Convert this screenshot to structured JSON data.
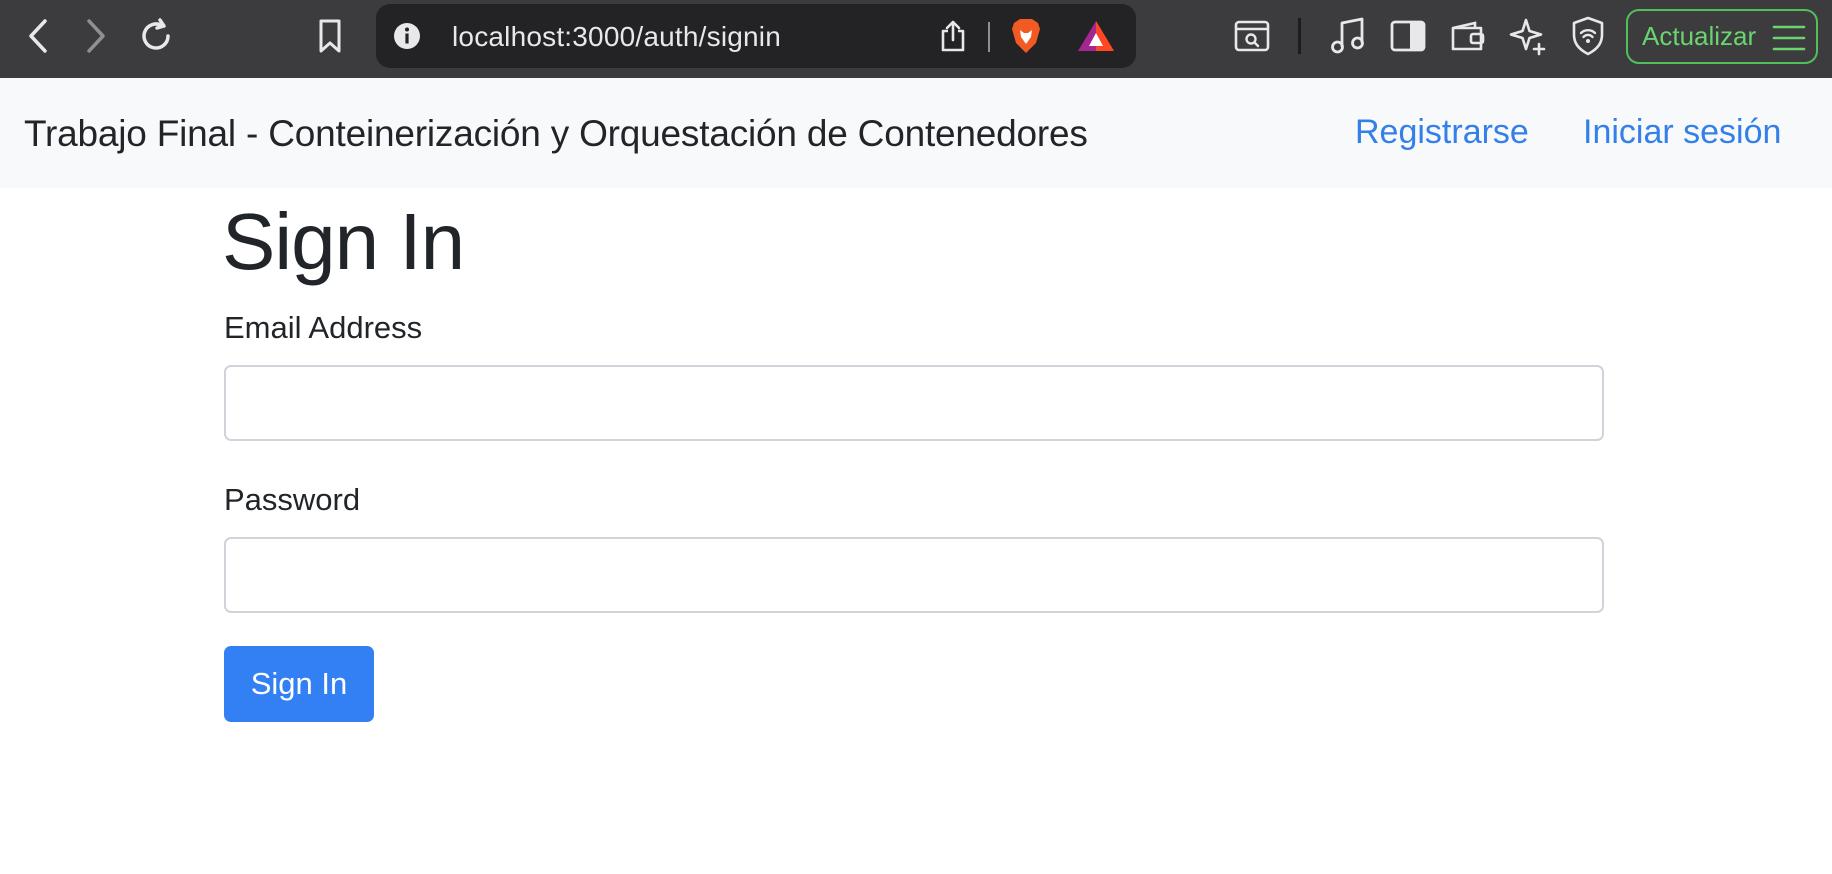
{
  "browser": {
    "url": "localhost:3000/auth/signin",
    "update_label": "Actualizar",
    "icons": [
      "back-icon",
      "forward-icon",
      "reload-icon",
      "bookmark-icon",
      "site-info-icon",
      "share-icon",
      "brave-shields-icon",
      "brave-rewards-icon",
      "reader-mode-icon",
      "media-icon",
      "sidebar-icon",
      "wallet-icon",
      "leo-ai-icon",
      "vpn-icon",
      "menu-icon"
    ],
    "colors": {
      "toolbar": "#3c3c3f",
      "urlbar": "#232326",
      "update_accent": "#4fc05a"
    }
  },
  "navbar": {
    "brand": "Trabajo Final - Conteinerización y Orquestación de Contenedores",
    "links": [
      {
        "label": "Registrarse"
      },
      {
        "label": "Iniciar sesión"
      }
    ]
  },
  "main": {
    "title": "Sign In",
    "email_label": "Email Address",
    "email_value": "",
    "password_label": "Password",
    "password_value": "",
    "submit_label": "Sign In"
  },
  "colors": {
    "link": "#3480e8",
    "primary": "#3380f4",
    "navbar_bg": "#f8f9fa"
  }
}
